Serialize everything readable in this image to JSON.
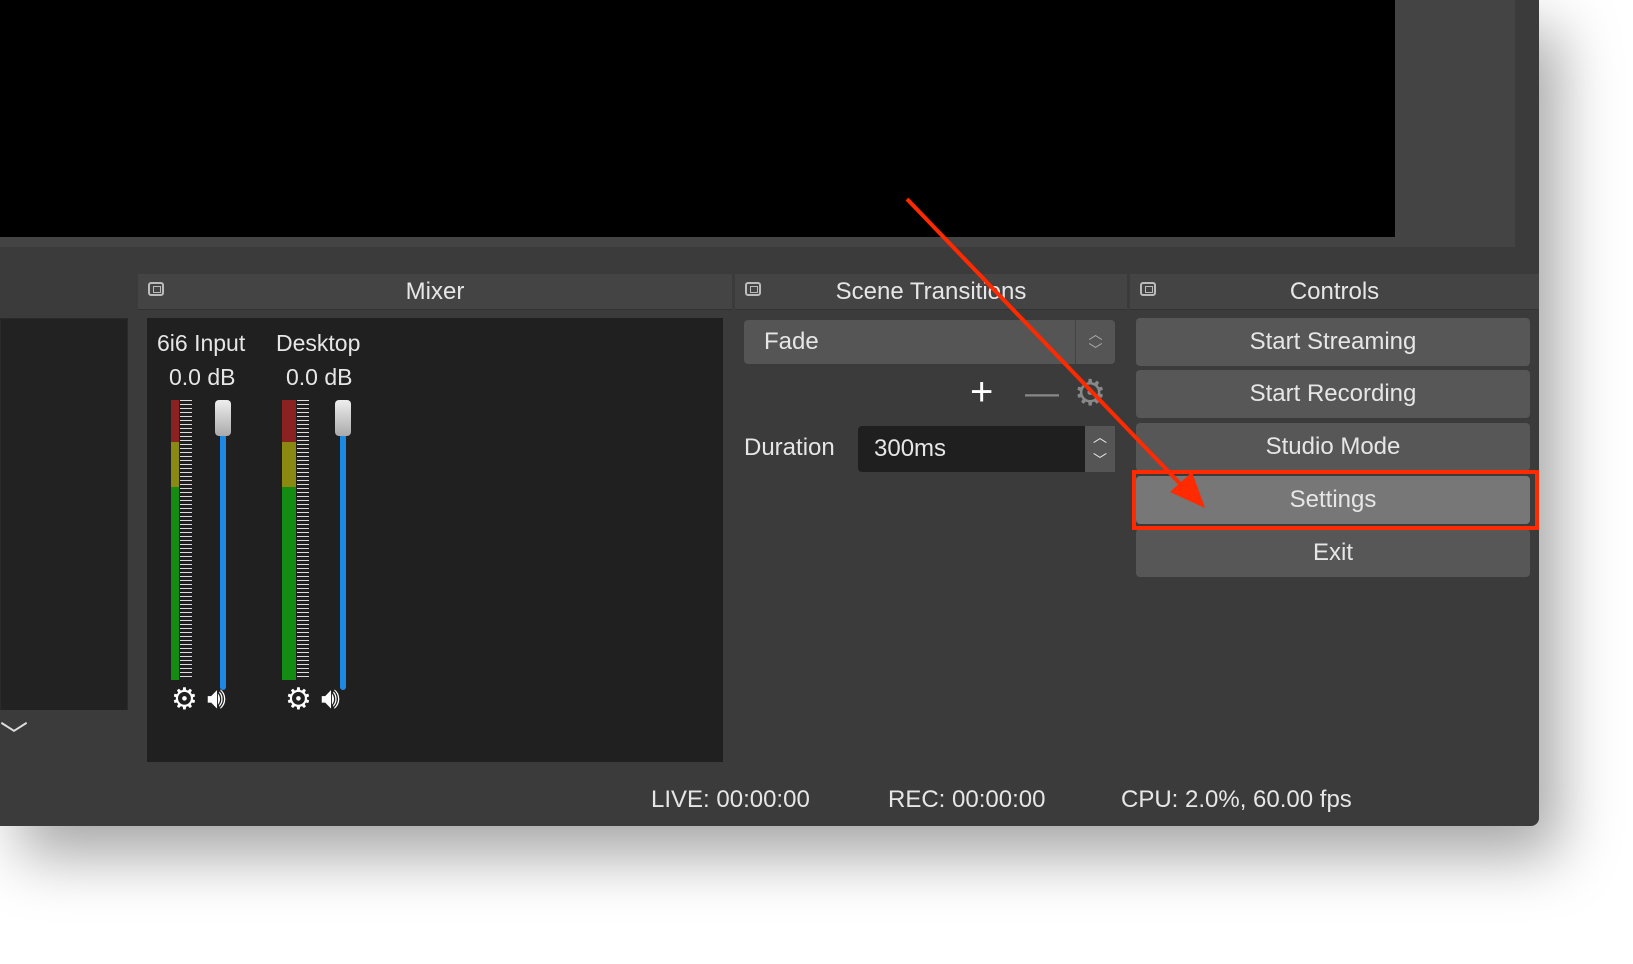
{
  "mixer": {
    "title": "Mixer",
    "channels": [
      {
        "name": "6i6 Input",
        "level": "0.0 dB",
        "volume_percent": 100
      },
      {
        "name": "Desktop",
        "level": "0.0 dB",
        "volume_percent": 100
      }
    ]
  },
  "transitions": {
    "title": "Scene Transitions",
    "selected": "Fade",
    "duration_label": "Duration",
    "duration_value": "300ms"
  },
  "controls": {
    "title": "Controls",
    "buttons": [
      "Start Streaming",
      "Start Recording",
      "Studio Mode",
      "Settings",
      "Exit"
    ],
    "highlighted": "Settings"
  },
  "status": {
    "live": "LIVE: 00:00:00",
    "rec": "REC: 00:00:00",
    "cpu": "CPU: 2.0%, 60.00 fps"
  },
  "colors": {
    "annotation": "#ff2a00",
    "fader": "#1e88e5"
  }
}
